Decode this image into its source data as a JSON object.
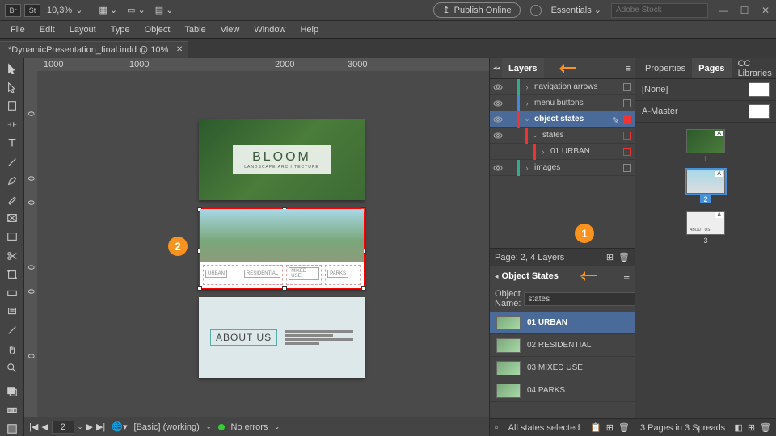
{
  "appbar": {
    "br": "Br",
    "st": "St",
    "zoom": "10,3%",
    "publish": "Publish Online",
    "workspace": "Essentials",
    "search_placeholder": "Adobe Stock"
  },
  "menu": [
    "File",
    "Edit",
    "Layout",
    "Type",
    "Object",
    "Table",
    "View",
    "Window",
    "Help"
  ],
  "doc_tab": "*DynamicPresentation_final.indd @ 10%",
  "ruler_marks": {
    "h": [
      "1000",
      "1000",
      "2000",
      "3000"
    ],
    "v": [
      "0",
      "1\n0",
      "0",
      "1\n0",
      "0",
      "1\n0"
    ]
  },
  "page1": {
    "title": "BLOOM",
    "subtitle": "LANDSCAPE ARCHITECTURE"
  },
  "page2": {
    "tabs": [
      "URBAN",
      "RESIDENTIAL",
      "MIXED USE",
      "PARKS"
    ]
  },
  "page3": {
    "title": "ABOUT US"
  },
  "callouts": {
    "one": "1",
    "two": "2"
  },
  "status": {
    "page": "2",
    "preset": "[Basic] (working)",
    "errors": "No errors"
  },
  "layers_panel": {
    "title": "Layers",
    "rows": [
      {
        "name": "navigation arrows",
        "depth": 0,
        "sel": false,
        "tw": "›"
      },
      {
        "name": "menu buttons",
        "depth": 0,
        "sel": false,
        "tw": "›"
      },
      {
        "name": "object states",
        "depth": 0,
        "sel": true,
        "tw": "⌄",
        "pen": true
      },
      {
        "name": "states",
        "depth": 1,
        "sel": false,
        "tw": "⌄"
      },
      {
        "name": "01 URBAN",
        "depth": 2,
        "sel": false,
        "tw": "›"
      },
      {
        "name": "images",
        "depth": 0,
        "sel": false,
        "tw": "›"
      }
    ],
    "footer": "Page: 2, 4 Layers"
  },
  "object_states": {
    "title": "Object States",
    "name_label": "Object Name:",
    "name_value": "states",
    "states": [
      {
        "label": "01 URBAN",
        "sel": true
      },
      {
        "label": "02 RESIDENTIAL",
        "sel": false
      },
      {
        "label": "03 MIXED USE",
        "sel": false
      },
      {
        "label": "04 PARKS",
        "sel": false
      }
    ],
    "footer": "All states selected"
  },
  "right_panel": {
    "tabs": [
      "Properties",
      "Pages",
      "CC Libraries"
    ],
    "none": "[None]",
    "master": "A-Master",
    "page_labels": [
      "1",
      "2",
      "3"
    ],
    "footer": "3 Pages in 3 Spreads"
  }
}
